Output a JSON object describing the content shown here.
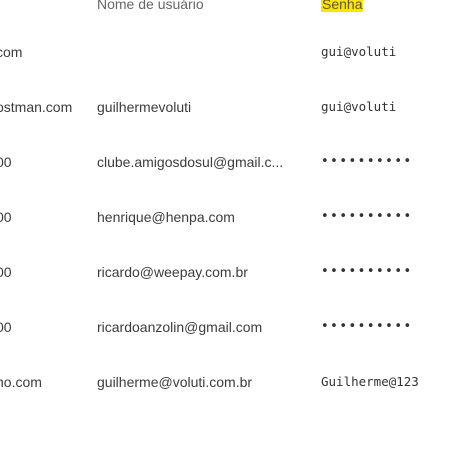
{
  "header": {
    "username_column": "Nome de usuário",
    "password_column": "Senha"
  },
  "rows": [
    {
      "site": "com",
      "username": "",
      "password": "gui@voluti"
    },
    {
      "site": "ostman.com",
      "username": "guilhermevoluti",
      "password": "gui@voluti"
    },
    {
      "site": "00",
      "username": "clube.amigosdosul@gmail.c...",
      "password": "••••••••••"
    },
    {
      "site": "00",
      "username": "henrique@henpa.com",
      "password": "••••••••••"
    },
    {
      "site": "00",
      "username": "ricardo@weepay.com.br",
      "password": "••••••••••"
    },
    {
      "site": "00",
      "username": "ricardoanzolin@gmail.com",
      "password": "••••••••••"
    },
    {
      "site": "no.com",
      "username": "guilherme@voluti.com.br",
      "password": "Guilherme@123"
    }
  ],
  "colors": {
    "highlight": "#ffe400",
    "text": "#3c3c3c",
    "header_text": "#666666"
  }
}
